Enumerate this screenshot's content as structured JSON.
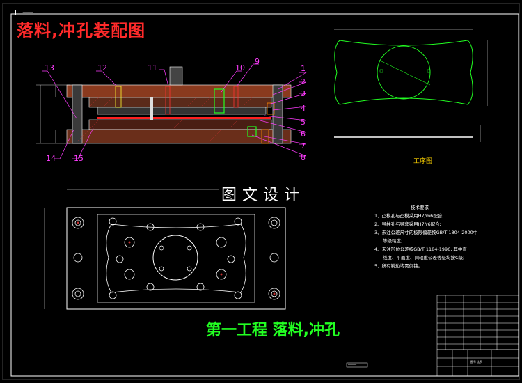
{
  "title": "落料,冲孔装配图",
  "stamp_text": "──────",
  "process_label": "工序图",
  "design_title": "图文设计",
  "stage_title": "第一工程   落料,冲孔",
  "technical": {
    "heading": "技术要求",
    "items": [
      "1、凸模孔与凸模采用H7/m6配合;",
      "2、导柱孔与导套采用H7/r6配合;",
      "3、未注公差尺寸的极限偏差按GB/T 1804-2000中",
      "等级精度;",
      "4、未注形位公差按GB/T 1184-1996, 其中直",
      "线度、平面度、同轴度公差等级均按C级;",
      "5、所有锐边均需倒钝。"
    ]
  },
  "callouts": [
    "1",
    "2",
    "3",
    "4",
    "5",
    "6",
    "7",
    "8",
    "9",
    "10",
    "11",
    "12",
    "13",
    "14",
    "15"
  ],
  "title_block": {
    "drawing_no": "─────",
    "scale": "图号 比例"
  },
  "colors": {
    "frame": "#ffffff",
    "callout": "#ff3cff",
    "leader": "#ff3cff",
    "outline": "#22ff22",
    "body": "#d0d0d0",
    "hatch": "#c63030",
    "title": "#ff2a2a"
  }
}
